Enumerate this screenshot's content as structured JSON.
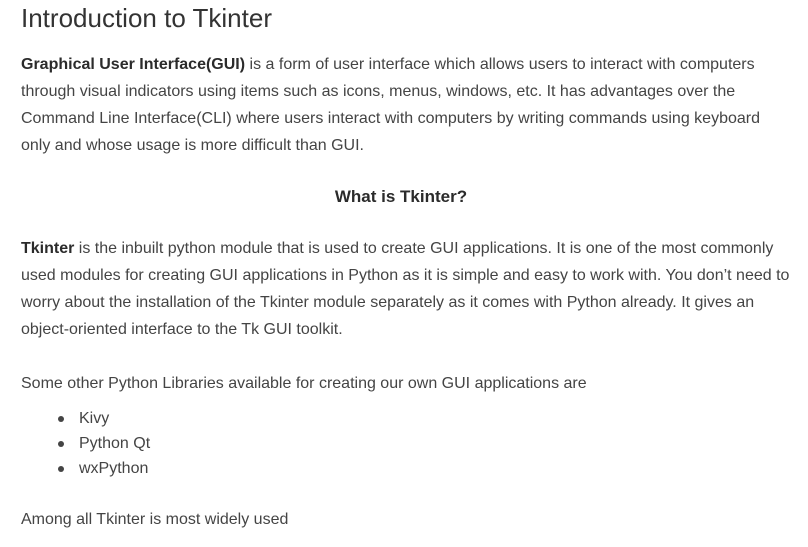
{
  "article": {
    "title": "Introduction to Tkinter",
    "intro": {
      "bold": "Graphical User Interface(GUI)",
      "text": " is a form of user interface which allows users to interact with computers through visual indicators using items such as icons, menus, windows, etc. It has advantages over the Command Line Interface(CLI) where users interact with computers by writing commands using keyboard only and whose usage is more difficult than GUI."
    },
    "subheading": "What is Tkinter?",
    "tkinter": {
      "bold": "Tkinter",
      "text": " is the inbuilt python module that is used to create GUI applications. It is one of the most commonly used modules for creating GUI applications in Python as it is simple and easy to work with. You don’t need to worry about the installation of the Tkinter module separately as it comes with Python already. It gives an object-oriented interface to the Tk GUI toolkit."
    },
    "libraries_intro": "Some other Python Libraries available for creating our own GUI applications are",
    "libraries": [
      "Kivy",
      "Python Qt",
      "wxPython"
    ],
    "closing": "Among all Tkinter is most widely used"
  }
}
